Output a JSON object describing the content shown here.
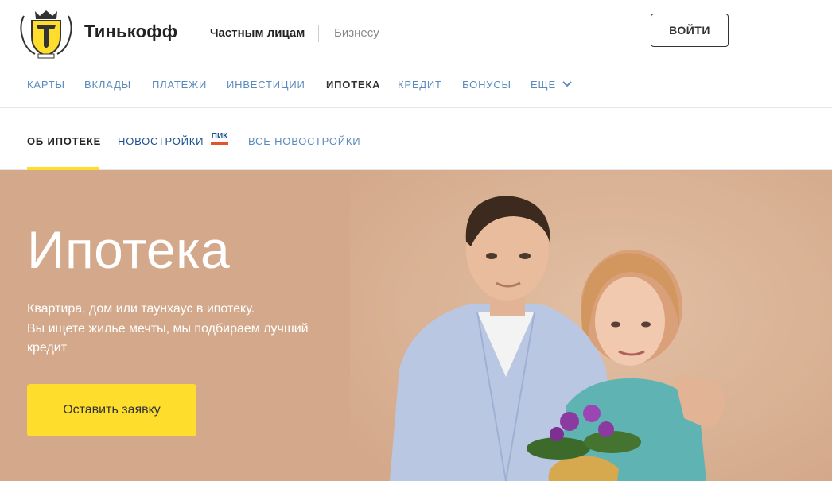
{
  "header": {
    "brand": "Тинькофф",
    "segments": {
      "private": "Частным лицам",
      "business": "Бизнесу"
    },
    "login_label": "ВОЙТИ"
  },
  "nav": {
    "items": [
      "КАРТЫ",
      "ВКЛАДЫ",
      "ПЛАТЕЖИ",
      "ИНВЕСТИЦИИ",
      "ИПОТЕКА",
      "КРЕДИТ",
      "БОНУСЫ",
      "ЕЩЕ"
    ],
    "active": "ИПОТЕКА"
  },
  "subnav": {
    "about": "ОБ ИПОТЕКЕ",
    "new_buildings": "НОВОСТРОЙКИ",
    "pik_logo": "ПИК",
    "all_new_buildings": "ВСЕ НОВОСТРОЙКИ"
  },
  "hero": {
    "title": "Ипотека",
    "description_lines": [
      "Квартира, дом или таунхаус в ипотеку.",
      "Вы ищете жилье мечты, мы подбираем лучший",
      "кредит"
    ],
    "cta_label": "Оставить заявку"
  },
  "colors": {
    "accent_yellow": "#ffdd2d",
    "hero_bg": "#d4a98b",
    "nav_link": "#5b8bbd"
  },
  "icons": [
    "tinkoff-logo-icon",
    "chevron-down-icon",
    "pik-logo-icon"
  ]
}
